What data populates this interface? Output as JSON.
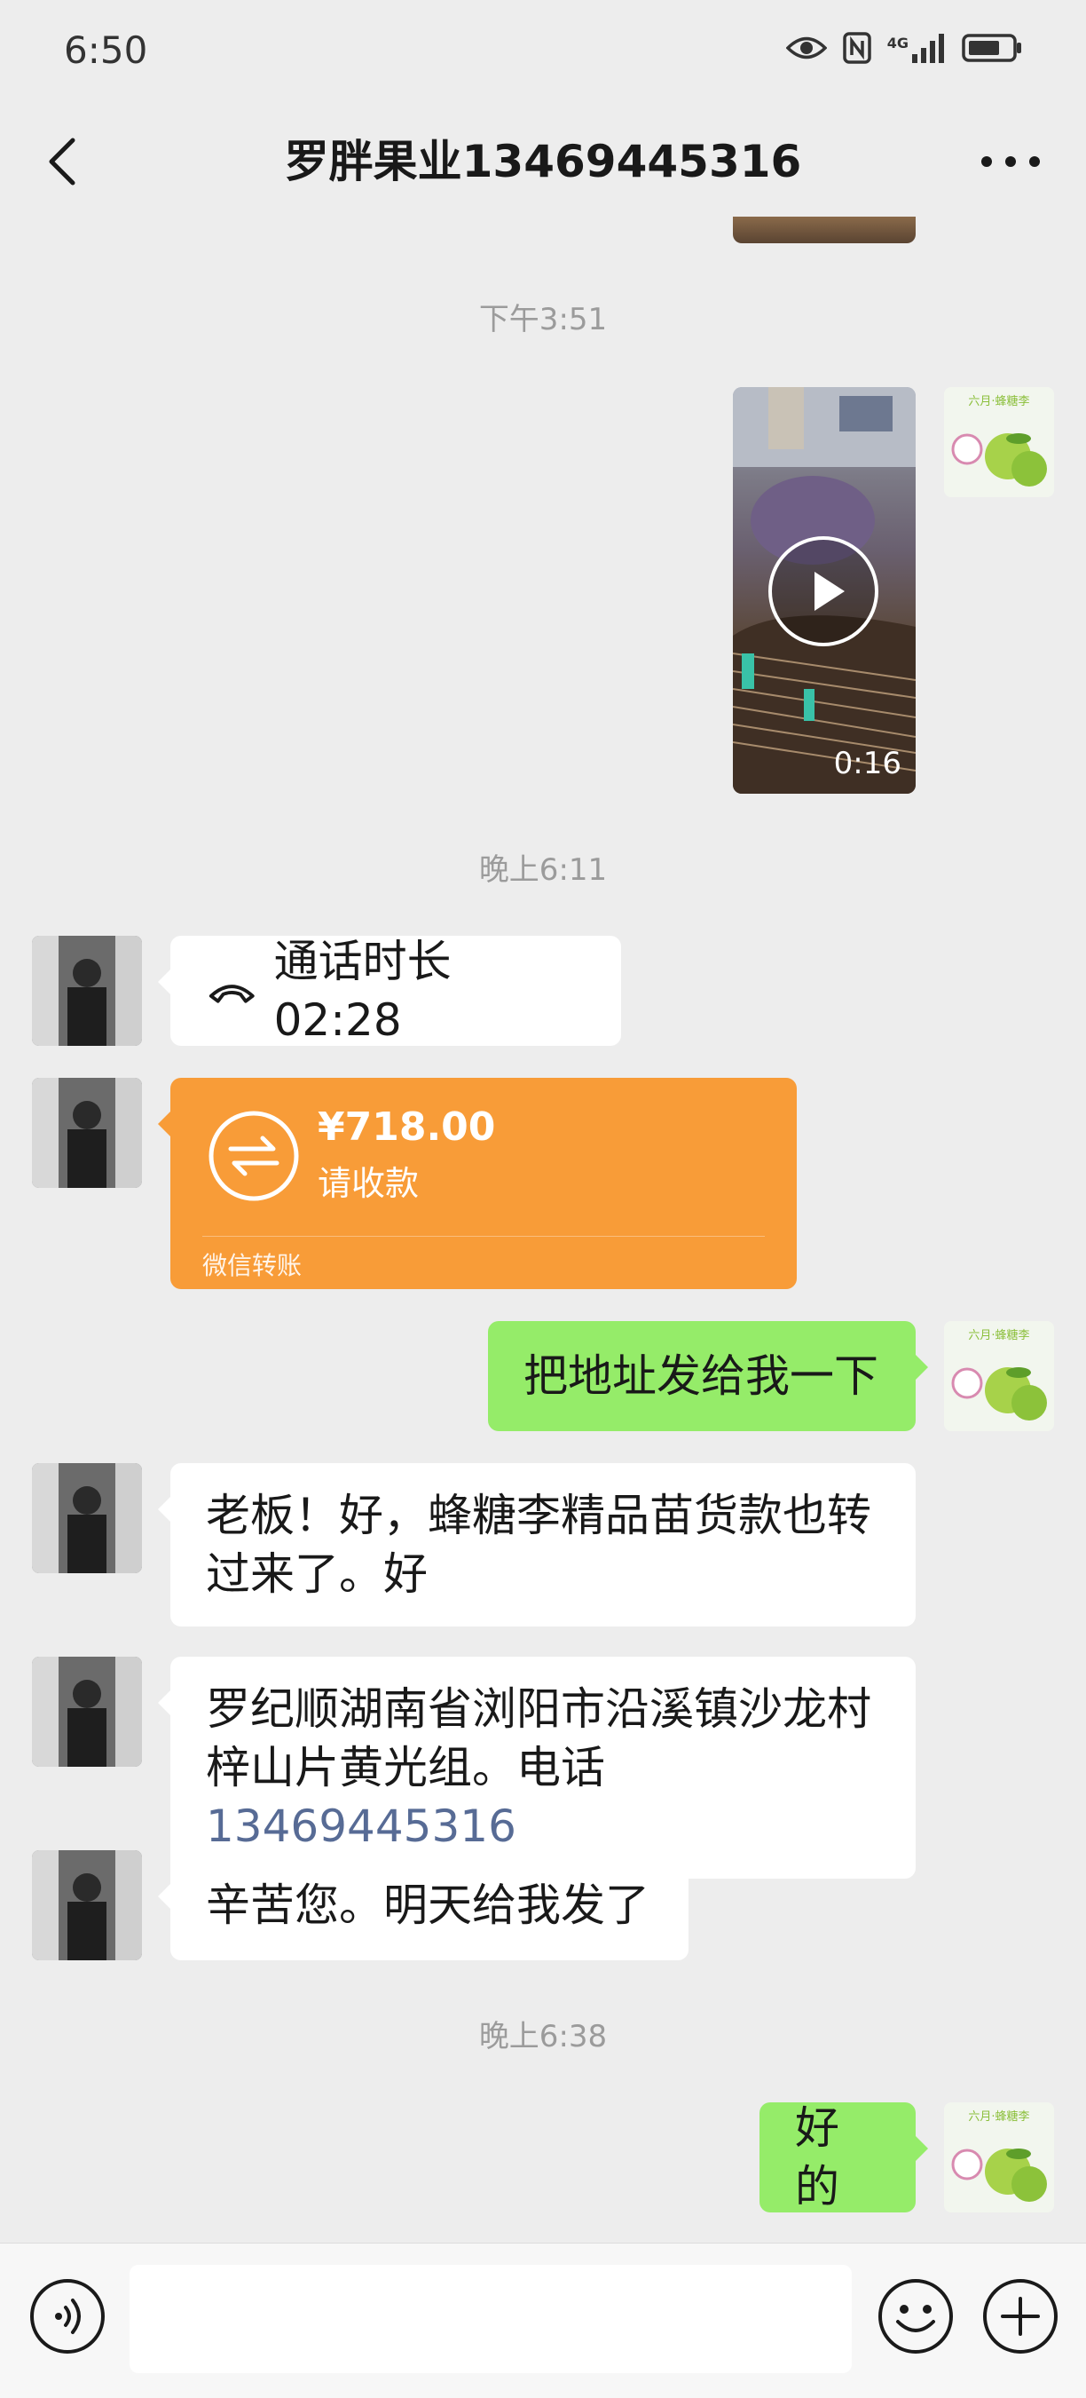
{
  "status_bar": {
    "time": "6:50",
    "network_label": "4G"
  },
  "header": {
    "title": "罗胖果业13469445316"
  },
  "thumb_text": "六月·蜂糖李",
  "timestamps": {
    "t1": "下午3:51",
    "t2": "晚上6:11",
    "t3": "晚上6:38"
  },
  "video": {
    "duration": "0:16"
  },
  "call": {
    "text": "通话时长 02:28"
  },
  "transfer": {
    "amount": "¥718.00",
    "note": "请收款",
    "source": "微信转账"
  },
  "messages": {
    "m1": "把地址发给我一下",
    "m2": "老板！好，蜂糖李精品苗货款也转过来了。好",
    "m3_text": "罗纪顺湖南省浏阳市沿溪镇沙龙村梓山片黄光组。电话",
    "m3_phone": "13469445316",
    "m4": "辛苦您。明天给我发了",
    "m5": "好的"
  },
  "colors": {
    "bubble_green": "#95ec69",
    "transfer_orange": "#f89c38",
    "link": "#576b95"
  }
}
